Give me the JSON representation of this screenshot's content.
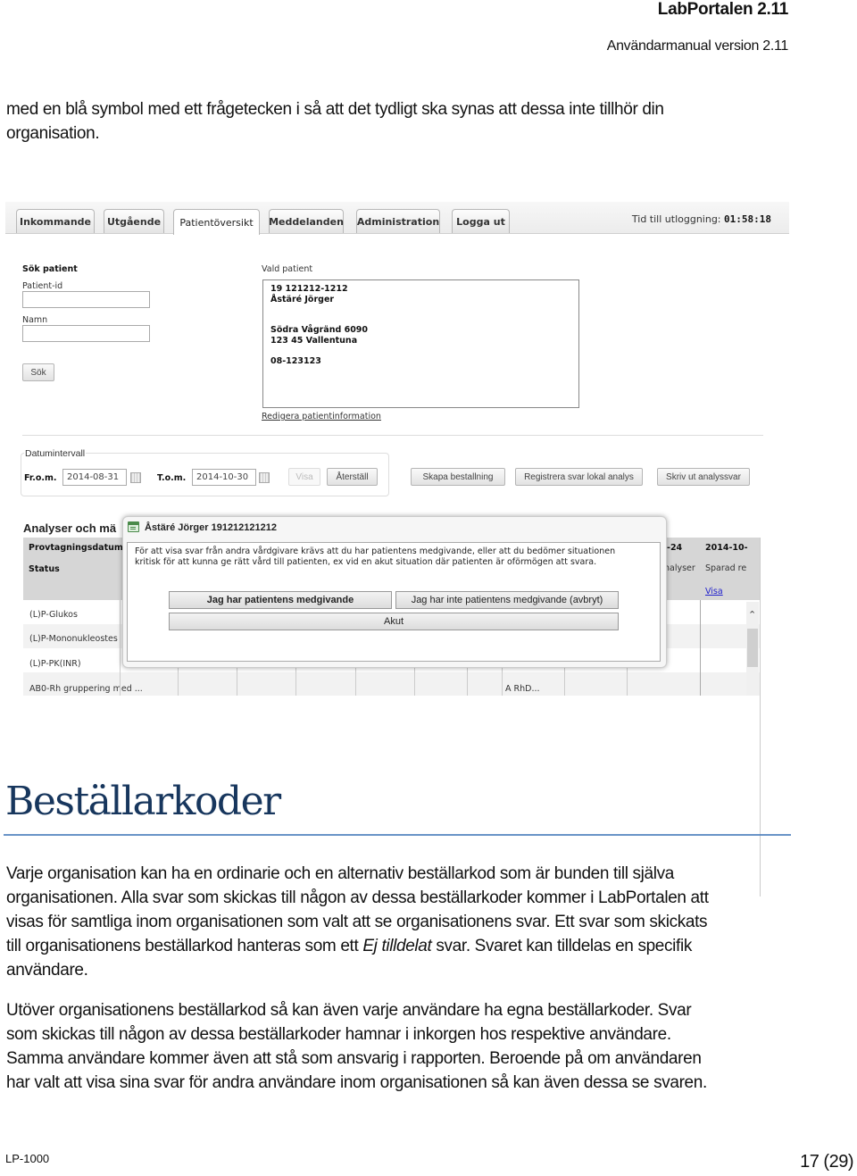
{
  "header": {
    "title": "LabPortalen 2.11",
    "subtitle": "Användarmanual version 2.11"
  },
  "intro_text": {
    "line1": "med en blå symbol med ett frågetecken i så att det tydligt ska synas att dessa inte tillhör din",
    "line2": "organisation."
  },
  "screenshot": {
    "tabs": [
      {
        "label": "Inkommande",
        "active": false
      },
      {
        "label": "Utgående",
        "active": false
      },
      {
        "label": "Patientöversikt",
        "active": true
      },
      {
        "label": "Meddelanden",
        "active": false
      },
      {
        "label": "Administration",
        "active": false
      },
      {
        "label": "Logga ut",
        "active": false
      }
    ],
    "timer_label": "Tid till utloggning:",
    "timer_value": "01:58:18",
    "search": {
      "heading": "Sök patient",
      "patient_id_label": "Patient-id",
      "patient_id_value": "",
      "name_label": "Namn",
      "name_value": "",
      "search_button": "Sök"
    },
    "selected_patient": {
      "label": "Vald patient",
      "id": "19 121212-1212",
      "name": "Åstäré Jörger",
      "street": "Södra Vågränd 6090",
      "city": "123 45 Vallentuna",
      "phone": "08-123123",
      "edit_link": "Redigera patientinformation"
    },
    "date_interval": {
      "legend": "Datumintervall",
      "from_label": "Fr.o.m.",
      "from_value": "2014-08-31",
      "to_label": "T.o.m.",
      "to_value": "2014-10-30",
      "show_button": "Visa",
      "reset_button": "Återställ"
    },
    "actions": {
      "create_order": "Skapa bestallning",
      "register_local": "Registrera svar lokal analys",
      "print_results": "Skriv ut analyssvar"
    },
    "table": {
      "title": "Analyser och mä",
      "header_row1": "Provtagningsdatum",
      "header_row2": "Status",
      "col_date_partial": "-24",
      "col_status_partial": "nalyser",
      "col2_date": "2014-10-",
      "col2_status": "Sparad re",
      "col2_link": "Visa",
      "rows": [
        {
          "name": "(L)P-Glukos"
        },
        {
          "name": "(L)P-Mononukleostes"
        },
        {
          "name": "(L)P-PK(INR)"
        },
        {
          "name": "AB0-Rh gruppering med ...",
          "value": "A RhD..."
        }
      ]
    },
    "dialog": {
      "title": "Åstäré Jörger 191212121212",
      "message_line1": "För att visa svar från andra vårdgivare krävs att du har patientens medgivande, eller att du bedömer situationen",
      "message_line2": "kritisk för att kunna ge rätt vård till patienten, ex vid en akut situation där patienten är oförmögen att svara.",
      "btn_consent": "Jag har patientens medgivande",
      "btn_no_consent": "Jag har inte patientens medgivande (avbryt)",
      "btn_emergency": "Akut"
    }
  },
  "section": {
    "heading": "Beställarkoder",
    "para1": [
      "Varje organisation kan ha en ordinarie och en alternativ beställarkod som är bunden till själva",
      "organisationen. Alla svar som skickas till någon av dessa beställarkoder kommer i LabPortalen att",
      "visas för samtliga inom organisationen som valt att se organisationens svar. Ett svar som skickats"
    ],
    "para1_line4_pre": "till organisationens beställarkod hanteras som ett ",
    "para1_line4_em": "Ej tilldelat",
    "para1_line4_post": " svar. Svaret kan tilldelas en specifik",
    "para1_line5": "användare.",
    "para2": [
      "Utöver organisationens beställarkod så kan även varje användare ha egna beställarkoder. Svar",
      "som skickas till någon av dessa beställarkoder hamnar i inkorgen hos respektive användare.",
      "Samma användare kommer även att stå som ansvarig i rapporten. Beroende på om användaren",
      "har valt att visa sina svar för andra användare inom organisationen så kan även dessa se svaren."
    ]
  },
  "footer": {
    "doc_id": "LP-1000",
    "page": "17 (29)"
  }
}
